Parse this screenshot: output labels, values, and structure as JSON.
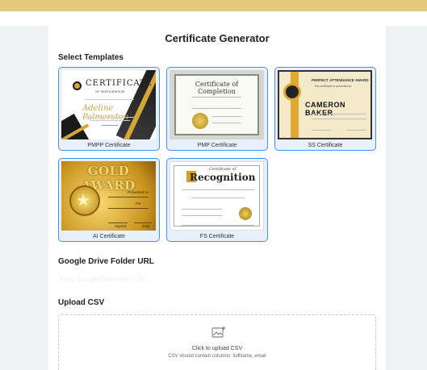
{
  "title": "Certificate Generator",
  "sections": {
    "templates": "Select Templates",
    "drive": "Google Drive Folder URL",
    "upload": "Upload CSV"
  },
  "templates": [
    {
      "id": "pmpp",
      "label": "PMPP Certificate",
      "selected": true,
      "thumb": {
        "title": "CERTIFICATE",
        "subtitle": "OF PARTICIPATION",
        "name": "Adeline Palmerston"
      }
    },
    {
      "id": "pmp",
      "label": "PMP Certificate",
      "selected": true,
      "thumb": {
        "title": "Certificate of Completion"
      }
    },
    {
      "id": "ss",
      "label": "SS Certificate",
      "selected": true,
      "thumb": {
        "heading": "PERFECT ATTENDANCE AWARD",
        "subheading": "this certificate is presented to",
        "name": "CAMERON BAKER"
      }
    },
    {
      "id": "ai",
      "label": "AI Certificate",
      "selected": true,
      "thumb": {
        "title": "GOLD AWARD",
        "presented": "Presented to",
        "for": "For",
        "signed": "Signed",
        "date": "Date"
      }
    },
    {
      "id": "fs",
      "label": "FS Certificate",
      "selected": true,
      "thumb": {
        "pre": "Certificate of",
        "title": "Recognition"
      }
    }
  ],
  "drive": {
    "placeholder": "Enter Google Drive folder URL",
    "value": ""
  },
  "upload": {
    "icon": "image-upload-icon",
    "main_text": "Click to upload CSV",
    "hint": "CSV should contain columns: fullName, email"
  },
  "colors": {
    "accent": "#4a90e2",
    "top_bar": "#e3c77a",
    "card_bg": "#e8f0fb"
  }
}
